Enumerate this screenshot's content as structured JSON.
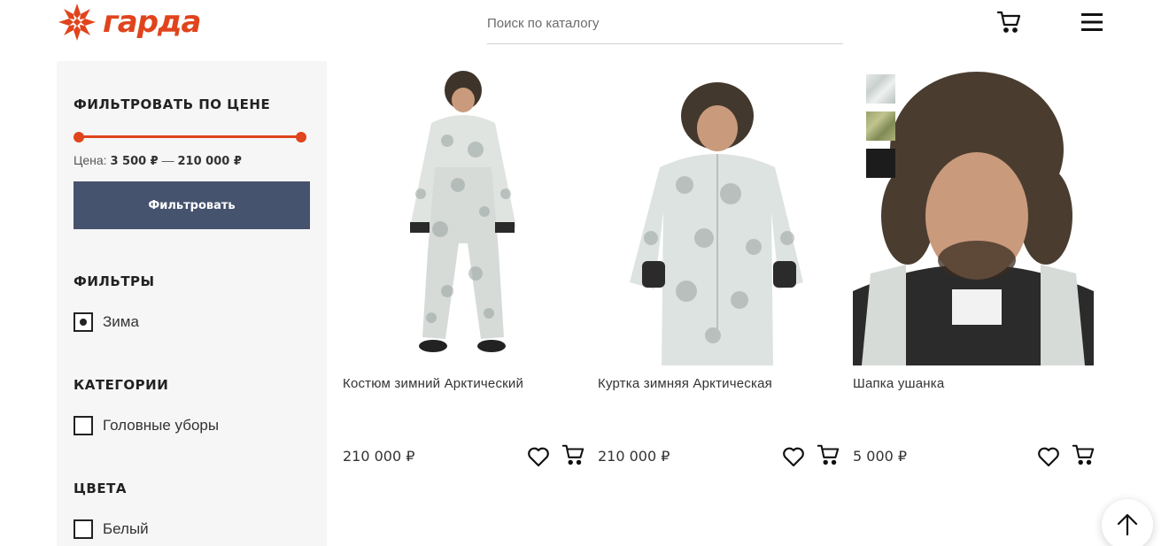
{
  "header": {
    "logo_text": "гарда",
    "search_placeholder": "Поиск по каталогу",
    "cart_icon": "cart-icon",
    "menu_icon": "hamburger-menu-icon"
  },
  "sidebar": {
    "price_filter": {
      "title": "ФИЛЬТРОВАТЬ ПО ЦЕНЕ",
      "price_label": "Цена:",
      "price_min": "3 500 ₽",
      "price_sep": "—",
      "price_max": "210 000 ₽",
      "button_label": "Фильтровать"
    },
    "filters": {
      "title": "ФИЛЬТРЫ",
      "items": [
        {
          "label": "Зима",
          "checked": true
        }
      ]
    },
    "categories": {
      "title": "КАТЕГОРИИ",
      "items": [
        {
          "label": "Головные уборы",
          "checked": false
        }
      ]
    },
    "colors": {
      "title": "ЦВЕТА",
      "items": [
        {
          "label": "Белый",
          "checked": false
        }
      ]
    }
  },
  "products": [
    {
      "name": "Костюм зимний Арктический",
      "price": "210 000 ₽"
    },
    {
      "name": "Куртка зимняя Арктическая",
      "price": "210 000 ₽"
    },
    {
      "name": "Шапка ушанка",
      "price": "5 000 ₽",
      "swatches": [
        "white-camo",
        "green-camo",
        "black"
      ]
    }
  ],
  "colors": {
    "accent": "#e0441c",
    "button": "#46536e",
    "sidebar_bg": "#f6f6f6"
  }
}
